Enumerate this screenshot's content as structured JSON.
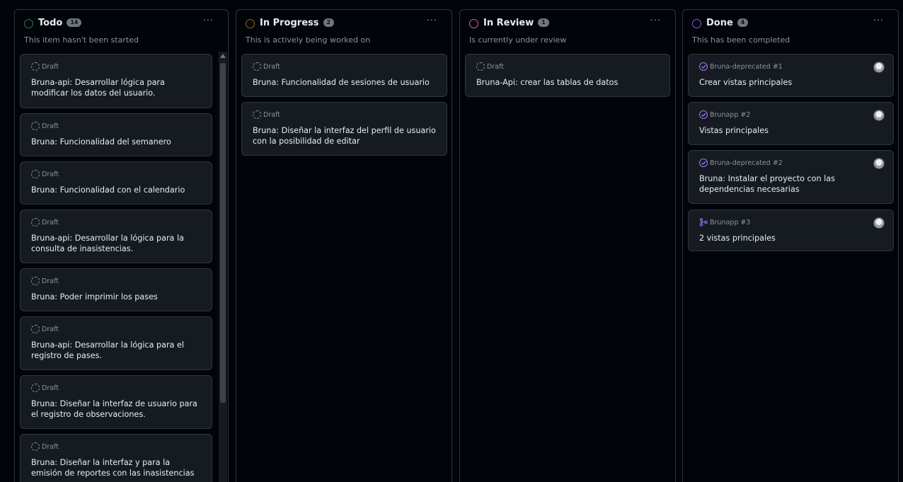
{
  "columns": [
    {
      "title": "Todo",
      "count": "14",
      "description": "This item hasn't been started",
      "color": "#238636",
      "cards": [
        {
          "meta": "Draft",
          "title": "Bruna-api: Desarrollar lógica para modificar los datos del usuario."
        },
        {
          "meta": "Draft",
          "title": "Bruna: Funcionalidad del semanero"
        },
        {
          "meta": "Draft",
          "title": "Bruna: Funcionalidad con el calendario"
        },
        {
          "meta": "Draft",
          "title": "Bruna-api: Desarrollar la lógica para la consulta de inasistencias."
        },
        {
          "meta": "Draft",
          "title": "Bruna: Poder imprimir los pases"
        },
        {
          "meta": "Draft",
          "title": "Bruna-api: Desarrollar la lógica para el registro de pases."
        },
        {
          "meta": "Draft",
          "title": "Bruna: Diseñar la interfaz de usuario para el registro de observaciones."
        },
        {
          "meta": "Draft",
          "title": "Bruna: Diseñar la interfaz y para la emisión de reportes con las inasistencias"
        }
      ]
    },
    {
      "title": "In Progress",
      "count": "2",
      "description": "This is actively being worked on",
      "color": "#9e6a03",
      "cards": [
        {
          "meta": "Draft",
          "title": "Bruna: Funcionalidad de sesiones de usuario"
        },
        {
          "meta": "Draft",
          "title": "Bruna: Diseñar la interfaz del perfil de usuario con la posibilidad de editar"
        }
      ]
    },
    {
      "title": "In Review",
      "count": "1",
      "description": "Is currently under review",
      "color": "#db61a2",
      "cards": [
        {
          "meta": "Draft",
          "title": "Bruna-Api: crear las tablas de datos"
        }
      ]
    },
    {
      "title": "Done",
      "count": "4",
      "description": "This has been completed",
      "color": "#8957e5",
      "cards": [
        {
          "meta": "Bruna-deprecated #1",
          "title": "Crear vistas principales",
          "icon": "closed-issue-icon"
        },
        {
          "meta": "Brunapp #2",
          "title": "Vistas principales",
          "icon": "closed-issue-icon"
        },
        {
          "meta": "Bruna-deprecated #2",
          "title": "Bruna: Instalar el proyecto con las dependencias necesarias",
          "icon": "closed-issue-icon"
        },
        {
          "meta": "Brunapp #3",
          "title": "2 vistas principales",
          "icon": "merged-pr-icon"
        }
      ]
    }
  ],
  "menu_label": "···"
}
